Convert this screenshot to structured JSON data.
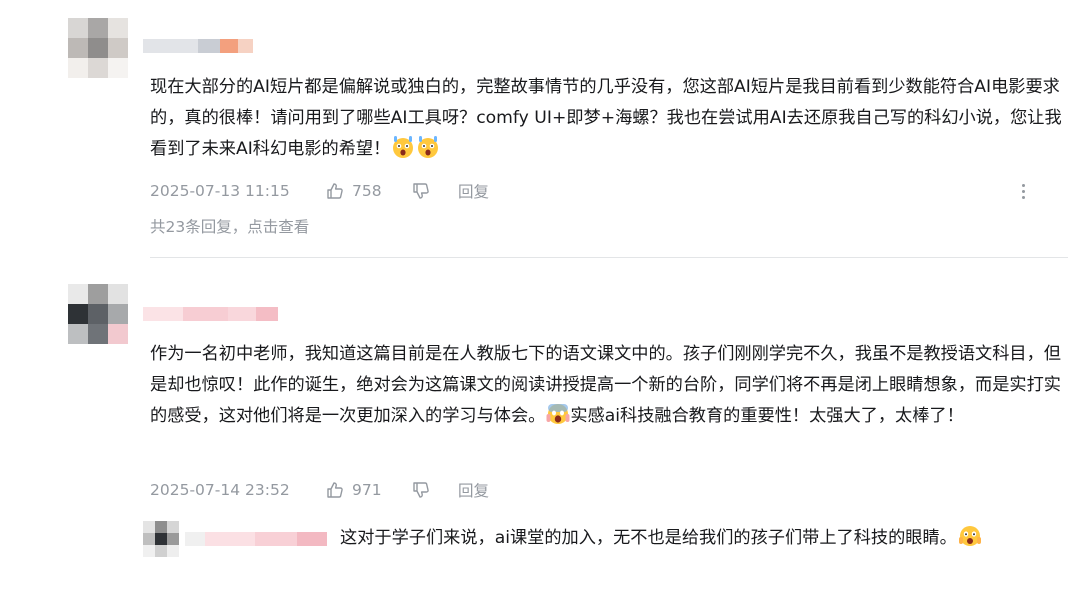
{
  "comments": [
    {
      "text": "现在大部分的AI短片都是偏解说或独白的，完整故事情节的几乎没有，您这部AI短片是我目前看到少数能符合AI电影要求的，真的很棒！请问用到了哪些AI工具呀？comfy UI+即梦+海螺？我也在尝试用AI去还原我自己写的科幻小说，您让我看到了未来AI科幻电影的希望！",
      "emoji_icons": [
        "shocked-face-icon",
        "shocked-face-icon"
      ],
      "time": "2025-07-13 11:15",
      "likes": "758",
      "reply_label": "回复",
      "view_replies": "共23条回复，点击查看"
    },
    {
      "text": "作为一名初中老师，我知道这篇目前是在人教版七下的语文课文中的。孩子们刚刚学完不久，我虽不是教授语文科目，但是却也惊叹！此作的诞生，绝对会为这篇课文的阅读讲授提高一个新的台阶，同学们将不再是闭上眼睛想象，而是实打实的感受，这对他们将是一次更加深入的学习与体会。",
      "text_after_emoji": "实感ai科技融合教育的重要性！太强大了，太棒了！",
      "emoji_icons": [
        "screaming-face-icon"
      ],
      "time": "2025-07-14 23:52",
      "likes": "971",
      "reply_label": "回复"
    }
  ],
  "sub_reply": {
    "text": "这对于学子们来说，ai课堂的加入，无不也是给我们的孩子们带上了科技的眼睛。",
    "emoji_icons": [
      "scared-face-icon"
    ]
  },
  "colors": {
    "text": "#18191c",
    "meta": "#9499a0",
    "divider": "#e3e5e7"
  }
}
